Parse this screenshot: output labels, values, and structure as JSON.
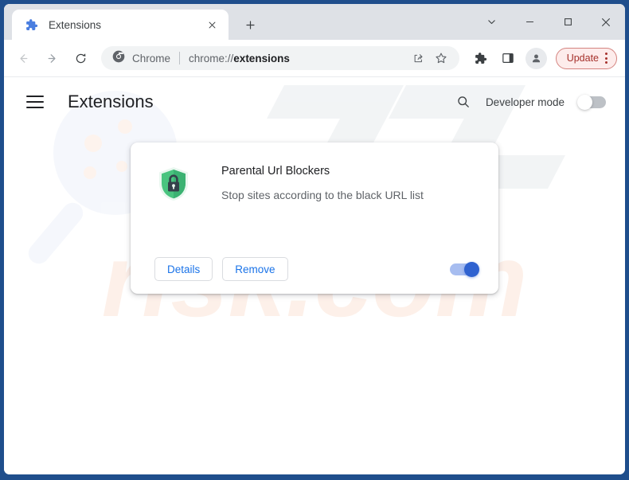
{
  "window": {
    "frame_color": "#1f4e8c",
    "controls": [
      {
        "name": "tab-search",
        "glyph": "chevron-down"
      },
      {
        "name": "minimize",
        "glyph": "minus"
      },
      {
        "name": "maximize",
        "glyph": "square"
      },
      {
        "name": "close",
        "glyph": "x"
      }
    ]
  },
  "tabstrip": {
    "tab": {
      "title": "Extensions",
      "favicon": "puzzle-piece-icon",
      "favicon_color": "#4a7ee0",
      "close_label": "×"
    },
    "new_tab_label": "+"
  },
  "toolbar": {
    "back_label": "←",
    "forward_label": "→",
    "reload_label": "↻",
    "omnibox": {
      "badge_label": "Chrome",
      "badge_icon": "chrome-logo-icon",
      "url_prefix": "chrome://",
      "url_emphasis": "extensions",
      "full_url": "chrome://extensions",
      "share_icon": "share-icon",
      "bookmark_icon": "star-icon"
    },
    "extensions_icon": "puzzle-piece-icon",
    "side_panel_icon": "side-panel-icon",
    "profile_icon": "person-avatar-icon",
    "update": {
      "label": "Update",
      "menu_icon": "three-dot-vertical-icon",
      "text_color": "#a5302a",
      "background_color": "#fdeceb",
      "border_color": "#d4837f"
    }
  },
  "page": {
    "header": {
      "menu_icon": "hamburger-menu-icon",
      "title": "Extensions",
      "search_icon": "search-icon",
      "developer_mode_label": "Developer mode",
      "developer_mode_enabled": false
    },
    "watermark": {
      "text_top": "PC",
      "text_bottom": "risk.com",
      "color": "#fdf0e9"
    },
    "extension_card": {
      "icon": "green-shield-lock-icon",
      "icon_color": "#3dbb7d",
      "name": "Parental Url Blockers",
      "description": "Stop sites according to the black URL list",
      "details_label": "Details",
      "remove_label": "Remove",
      "enabled": true,
      "toggle_color": "#2f62d0"
    }
  }
}
